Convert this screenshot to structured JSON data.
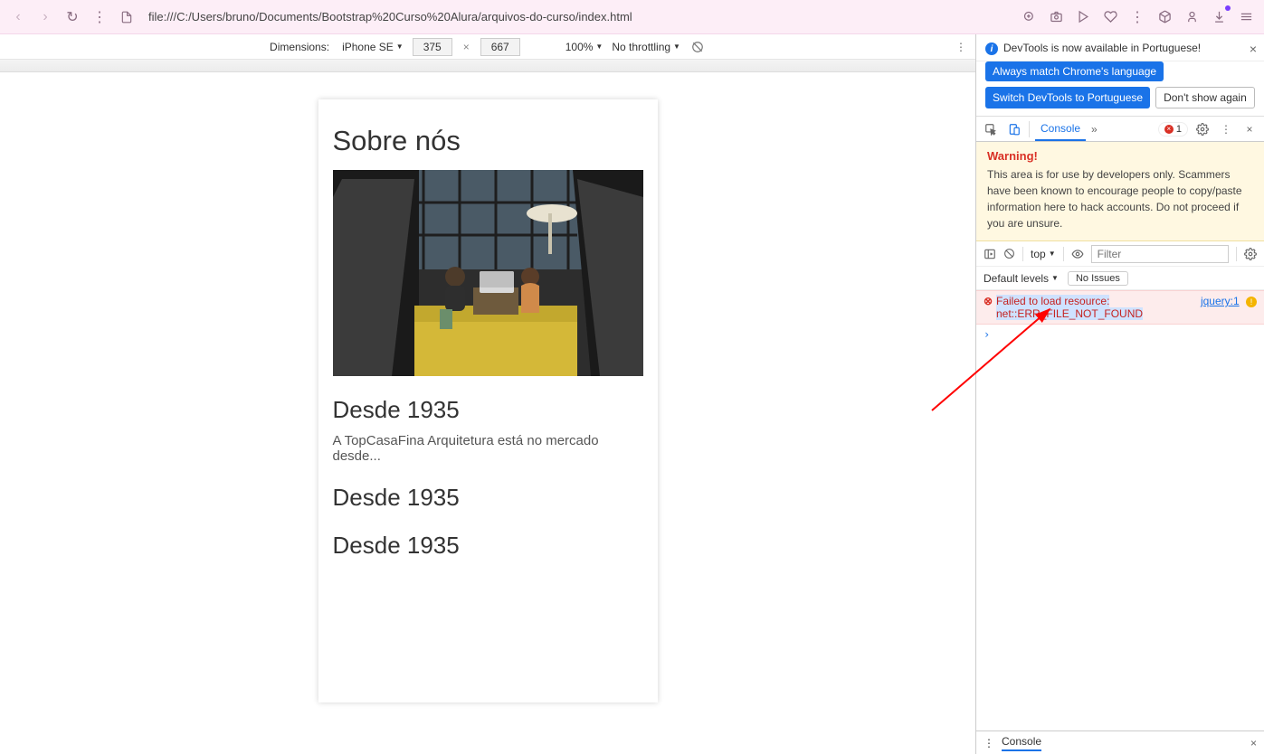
{
  "browser": {
    "url": "file:///C:/Users/bruno/Documents/Bootstrap%20Curso%20Alura/arquivos-do-curso/index.html"
  },
  "device_toolbar": {
    "dimensions_label": "Dimensions:",
    "device": "iPhone SE",
    "width": "375",
    "height": "667",
    "zoom": "100%",
    "throttling": "No throttling"
  },
  "page": {
    "title": "Sobre nós",
    "h3_1": "Desde 1935",
    "para": "A TopCasaFina Arquitetura está no mercado desde...",
    "h3_2": "Desde 1935",
    "h3_3": "Desde 1935"
  },
  "devtools": {
    "info_msg": "DevTools is now available in Portuguese!",
    "btn_always": "Always match Chrome's language",
    "btn_switch": "Switch DevTools to Portuguese",
    "btn_dont": "Don't show again",
    "tab_console": "Console",
    "error_count": "1",
    "warning_title": "Warning!",
    "warning_body": "This area is for use by developers only. Scammers have been known to encourage people to copy/paste information here to hack accounts. Do not proceed if you are unsure.",
    "context": "top",
    "filter_placeholder": "Filter",
    "levels": "Default levels",
    "no_issues": "No Issues",
    "err_line1": "Failed to load resource:",
    "err_line2": "net::ERR_FILE_NOT_FOUND",
    "err_src": "jquery:1",
    "drawer_tab": "Console"
  }
}
